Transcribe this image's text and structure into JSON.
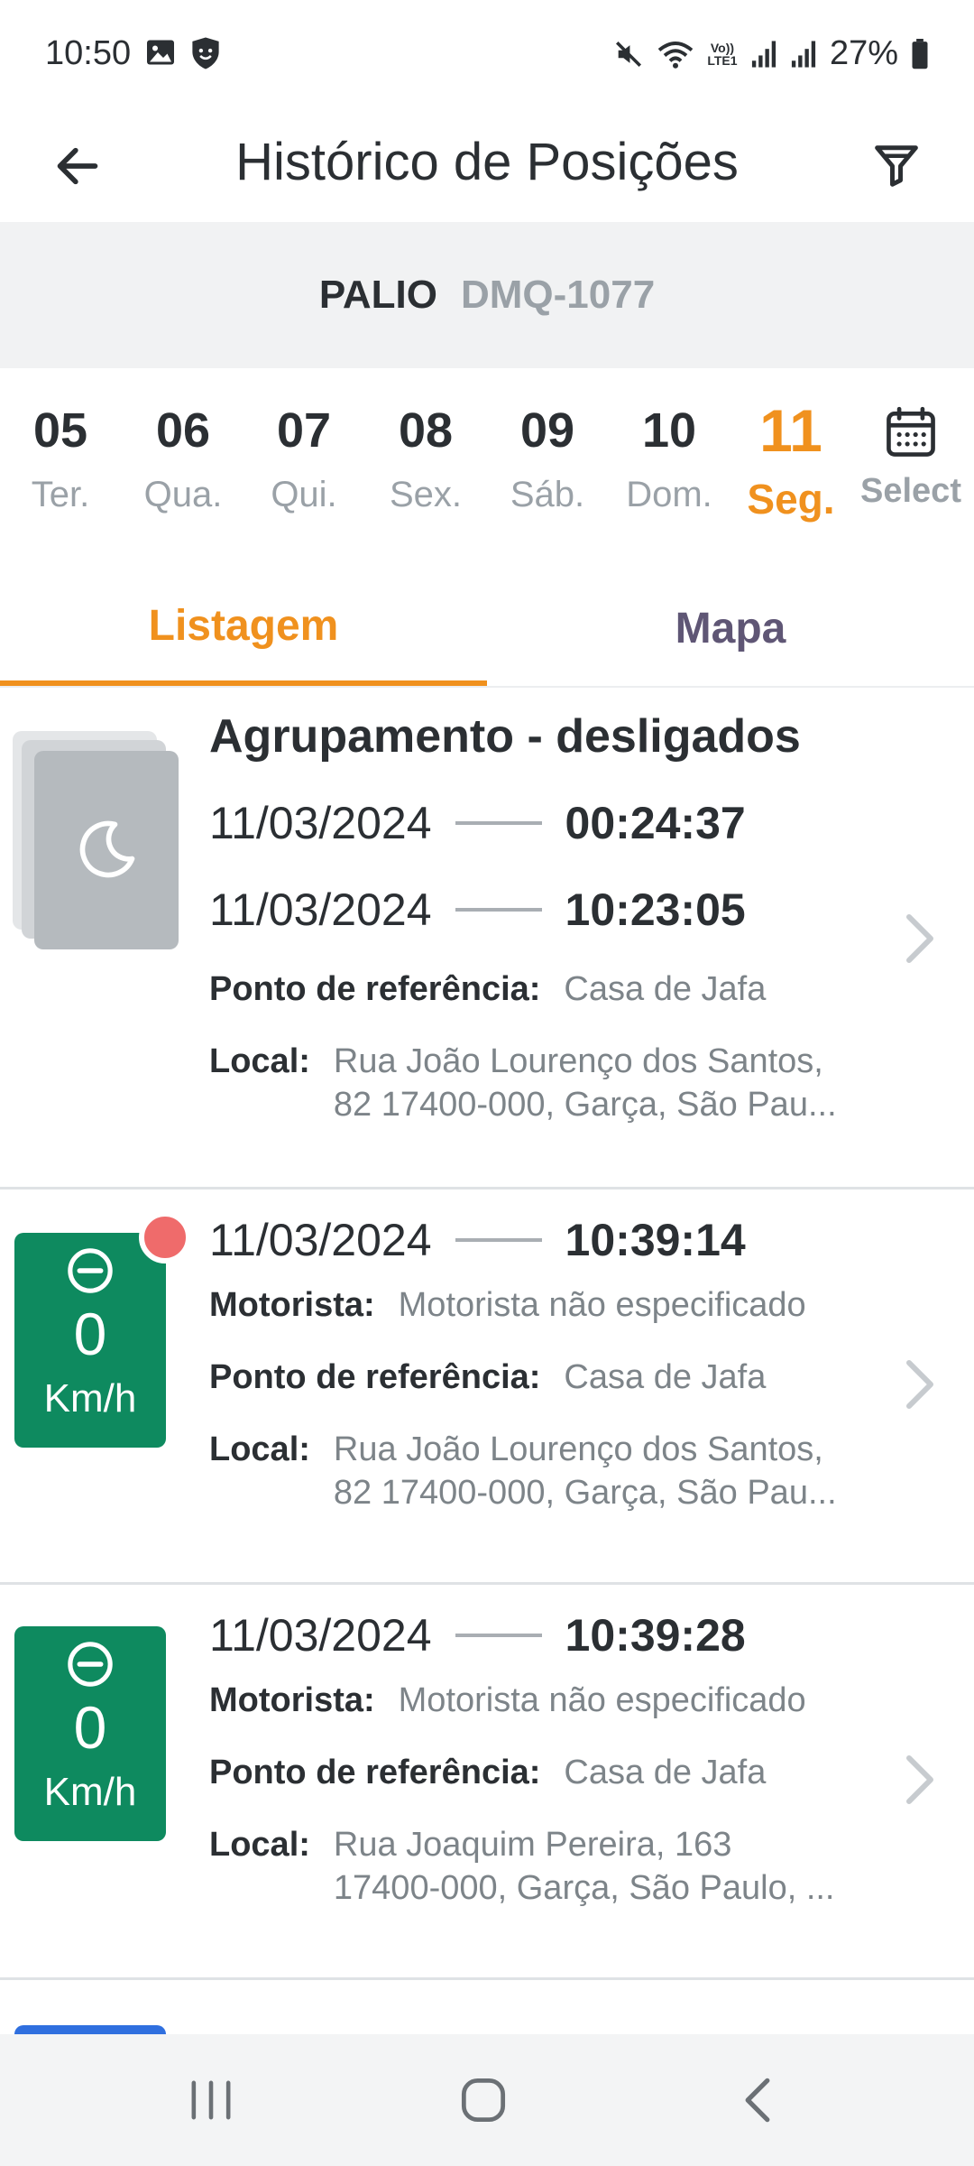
{
  "status_bar": {
    "time": "10:50",
    "battery": "27%",
    "icons": [
      "image-icon",
      "shield-face-icon",
      "mute-icon",
      "wifi-icon",
      "volte-icon",
      "signal-icon",
      "signal-icon-2",
      "battery-icon"
    ],
    "volte_label": "Vo)) LTE1"
  },
  "header": {
    "title": "Histórico de Posições",
    "back_icon": "arrow-left-icon",
    "filter_icon": "filter-icon"
  },
  "vehicle": {
    "name": "PALIO",
    "plate": "DMQ-1077"
  },
  "dates": {
    "days": [
      {
        "num": "05",
        "weekday": "Ter."
      },
      {
        "num": "06",
        "weekday": "Qua."
      },
      {
        "num": "07",
        "weekday": "Qui."
      },
      {
        "num": "08",
        "weekday": "Sex."
      },
      {
        "num": "09",
        "weekday": "Sáb."
      },
      {
        "num": "10",
        "weekday": "Dom."
      },
      {
        "num": "11",
        "weekday": "Seg."
      }
    ],
    "active_index": 6,
    "select_label": "Select"
  },
  "tabs": {
    "list": "Listagem",
    "map": "Mapa",
    "active": "list"
  },
  "labels": {
    "driver": "Motorista:",
    "reference": "Ponto de referência:",
    "local": "Local:"
  },
  "items": [
    {
      "type": "group",
      "title": "Agrupamento - desligados",
      "start_date": "11/03/2024",
      "start_time": "00:24:37",
      "end_date": "11/03/2024",
      "end_time": "10:23:05",
      "reference": "Casa de Jafa",
      "local_line1": "Rua João Lourenço dos Santos,",
      "local_line2": "82 17400-000, Garça, São Pau..."
    },
    {
      "type": "position",
      "speed": "0",
      "unit": "Km/h",
      "alert": true,
      "date": "11/03/2024",
      "time": "10:39:14",
      "driver": "Motorista não especificado",
      "reference": "Casa de Jafa",
      "local_line1": "Rua João Lourenço dos Santos,",
      "local_line2": "82 17400-000, Garça, São Pau..."
    },
    {
      "type": "position",
      "speed": "0",
      "unit": "Km/h",
      "alert": false,
      "date": "11/03/2024",
      "time": "10:39:28",
      "driver": "Motorista não especificado",
      "reference": "Casa de Jafa",
      "local_line1": "Rua Joaquim Pereira, 163",
      "local_line2": "17400-000, Garça, São Paulo, ..."
    }
  ],
  "colors": {
    "accent": "#f0911e",
    "speed_badge": "#0e8a5f",
    "alert": "#ef6b6b",
    "muted": "#9aa1a7",
    "tab_inactive": "#5f5675",
    "next_badge": "#2f6fdf"
  },
  "nav_bar": {
    "recents_icon": "recents-icon",
    "home_icon": "home-icon",
    "back_icon": "back-chevron-icon"
  }
}
